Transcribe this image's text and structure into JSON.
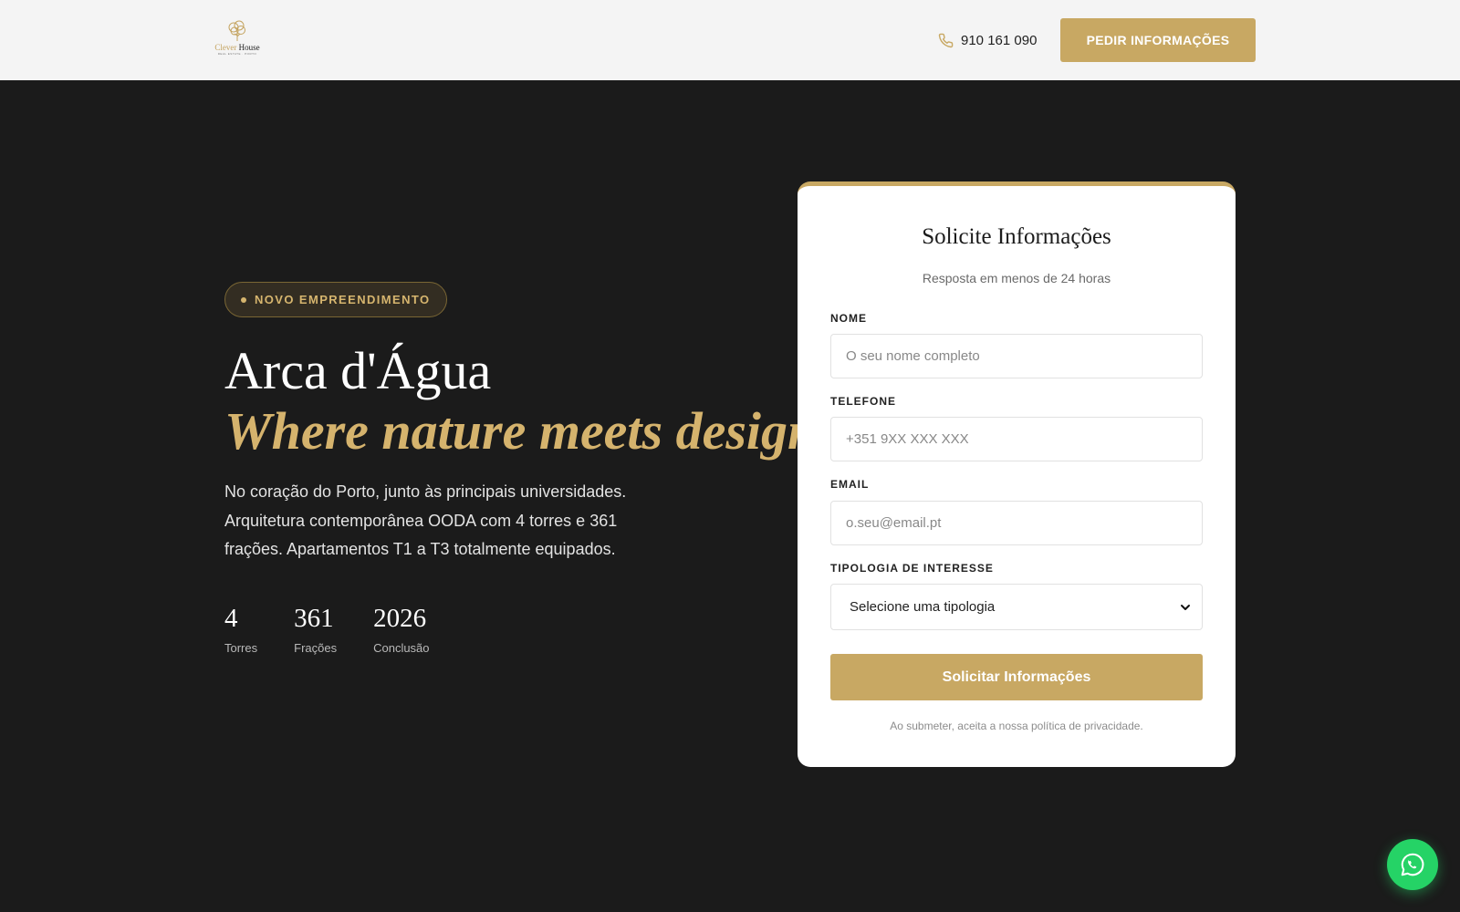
{
  "header": {
    "logo": {
      "brand_accent": "Clever",
      "brand_main": " House",
      "tagline": "REAL ESTATE · PORTO"
    },
    "phone": {
      "icon": "phone-icon",
      "number": "910 161 090"
    },
    "cta_label": "PEDIR INFORMAÇÕES"
  },
  "hero": {
    "badge": "NOVO EMPREENDIMENTO",
    "title": "Arca d'Água",
    "subtitle": "Where nature meets design",
    "description": "No coração do Porto, junto às principais universidades. Arquitetura contemporânea OODA com 4 torres e 361 frações. Apartamentos T1 a T3 totalmente equipados.",
    "stats": [
      {
        "value": "4",
        "label": "Torres"
      },
      {
        "value": "361",
        "label": "Frações"
      },
      {
        "value": "2026",
        "label": "Conclusão"
      }
    ]
  },
  "form": {
    "title": "Solicite Informações",
    "subtitle": "Resposta em menos de 24 horas",
    "fields": {
      "nome": {
        "label": "NOME",
        "placeholder": "O seu nome completo",
        "value": ""
      },
      "telefone": {
        "label": "TELEFONE",
        "placeholder": "+351 9XX XXX XXX",
        "value": ""
      },
      "email": {
        "label": "EMAIL",
        "placeholder": "o.seu@email.pt",
        "value": ""
      },
      "tipologia": {
        "label": "TIPOLOGIA DE INTERESSE",
        "selected": "Selecione uma tipologia"
      }
    },
    "submit_label": "Solicitar Informações",
    "privacy": "Ao submeter, aceita a nossa política de privacidade."
  },
  "floating": {
    "icon": "whatsapp-icon"
  },
  "colors": {
    "accent": "#c8a863",
    "accent_text": "#d5b36d",
    "background": "#1b1b1b",
    "header_bg": "#f4f4f4",
    "whatsapp": "#25d366"
  }
}
